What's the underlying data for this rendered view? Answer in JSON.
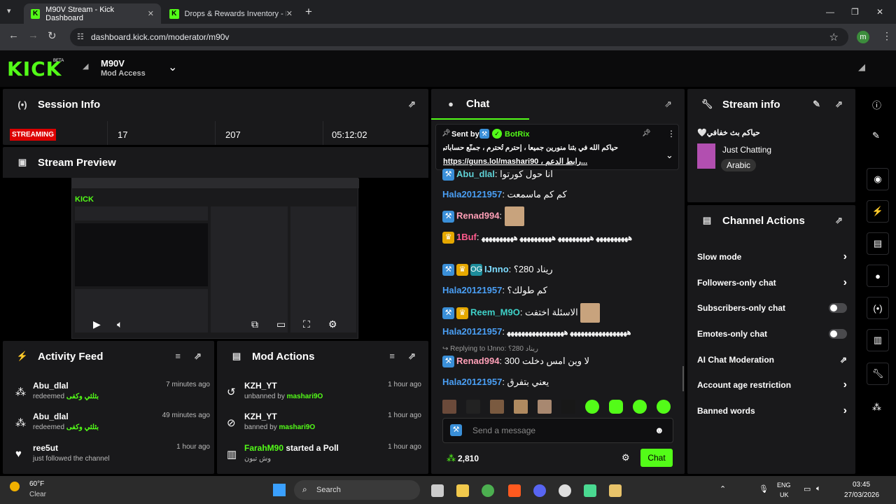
{
  "browser": {
    "tabs": [
      {
        "title": "M90V Stream - Kick Dashboard",
        "close": "✕"
      },
      {
        "title": "Drops & Rewards Inventory - Ki",
        "close": "✕"
      }
    ],
    "new_tab": "+",
    "url": "dashboard.kick.com/moderator/m90v",
    "profile_initial": "m"
  },
  "header": {
    "logo": "KICK",
    "beta": "BETA",
    "channel_name": "M90V",
    "role": "Mod Access"
  },
  "session": {
    "title": "Session Info",
    "status": "STREAMING",
    "viewers": "17",
    "followers": "207",
    "duration": "05:12:02"
  },
  "preview": {
    "title": "Stream Preview"
  },
  "activity": {
    "title": "Activity Feed",
    "items": [
      {
        "name": "Abu_dlal",
        "action": "redeemed",
        "reward": "بثلثي وكفى",
        "time": "7 minutes ago"
      },
      {
        "name": "Abu_dlal",
        "action": "redeemed",
        "reward": "بثلثي وكفى",
        "time": "49 minutes ago"
      },
      {
        "name": "ree5ut",
        "action": "just followed the channel",
        "reward": "",
        "time": "1 hour ago"
      }
    ]
  },
  "mod_actions": {
    "title": "Mod Actions",
    "items": [
      {
        "name": "KZH_YT",
        "action": "unbanned by",
        "by": "mashari9O",
        "time": "1 hour ago"
      },
      {
        "name": "KZH_YT",
        "action": "banned by",
        "by": "mashari9O",
        "time": "1 hour ago"
      },
      {
        "name": "FarahM90",
        "action": "started a Poll",
        "by": "وش تبون",
        "time": "1 hour ago"
      }
    ]
  },
  "chat": {
    "title": "Chat",
    "pinned": {
      "sent_by": "Sent by",
      "author": "BotRix",
      "line1": "حياكم الله في بثنا منورين جميعا ، إحترم تُحترم ، جمنّع حساباتي",
      "line2": "https://guns.lol/mashari90 ، رابط الدعم...",
      "link": "https://guns.lol/mashari90"
    },
    "messages": [
      {
        "user": "Abu_dlal",
        "color": "#5fd1d6",
        "text": "انا حول كورتوا"
      },
      {
        "user": "Hala20121957",
        "color": "#4a9ff5",
        "text": "كم كم ماسمعت"
      },
      {
        "user": "Renad994",
        "color": "#ff9fb7",
        "text": ""
      },
      {
        "user": "1Buf",
        "color": "#ff5b8d",
        "text": "ﻫﻬﻬﻬﻬﻬﻬﻬﻬﻬ ﻫﻬﻬﻬﻬﻬﻬﻬﻬﻬ ﻫﻬﻬﻬﻬﻬﻬﻬﻬﻬ ﻫﻬﻬﻬﻬﻬﻬﻬﻬﻬ"
      },
      {
        "user": "IJnno",
        "color": "#7ddcff",
        "text": "ريناد 280؟"
      },
      {
        "user": "Hala20121957",
        "color": "#4a9ff5",
        "text": "كم طولك؟"
      },
      {
        "user": "Reem_M9O",
        "color": "#3fd1c8",
        "text": "الاسئلة اختفت"
      },
      {
        "user": "Hala20121957",
        "color": "#4a9ff5",
        "text": "ﻫﻬﻬﻬﻬﻬﻬﻬﻬﻬﻬﻬﻬﻬﻬﻬﻬ ﻫﻬﻬﻬﻬﻬﻬﻬﻬﻬﻬﻬﻬﻬﻬﻬﻬ"
      },
      {
        "user": "Renad994",
        "color": "#ff9fb7",
        "text": "لا وين امس دخلت 300"
      },
      {
        "user": "Hala20121957",
        "color": "#4a9ff5",
        "text": "يعني بتفرق"
      }
    ],
    "reply_to": "Replying to IJnno: ريناد 280؟",
    "input_placeholder": "Send a message",
    "points": "2,810",
    "send_label": "Chat"
  },
  "stream_info": {
    "title": "Stream info",
    "stream_title": "حياكم بث خفافي🤍",
    "category": "Just Chatting",
    "language": "Arabic"
  },
  "channel_actions": {
    "title": "Channel Actions",
    "items": [
      {
        "label": "Slow mode",
        "control": "chevron"
      },
      {
        "label": "Followers-only chat",
        "control": "chevron"
      },
      {
        "label": "Subscribers-only chat",
        "control": "toggle"
      },
      {
        "label": "Emotes-only chat",
        "control": "toggle"
      },
      {
        "label": "AI Chat Moderation",
        "control": "external"
      },
      {
        "label": "Account age restriction",
        "control": "chevron"
      },
      {
        "label": "Banned words",
        "control": "chevron"
      }
    ]
  },
  "taskbar": {
    "weather_temp": "60°F",
    "weather_desc": "Clear",
    "search": "Search",
    "lang1": "ENG",
    "lang2": "UK",
    "time": "03:45",
    "date": "27/03/2026"
  }
}
